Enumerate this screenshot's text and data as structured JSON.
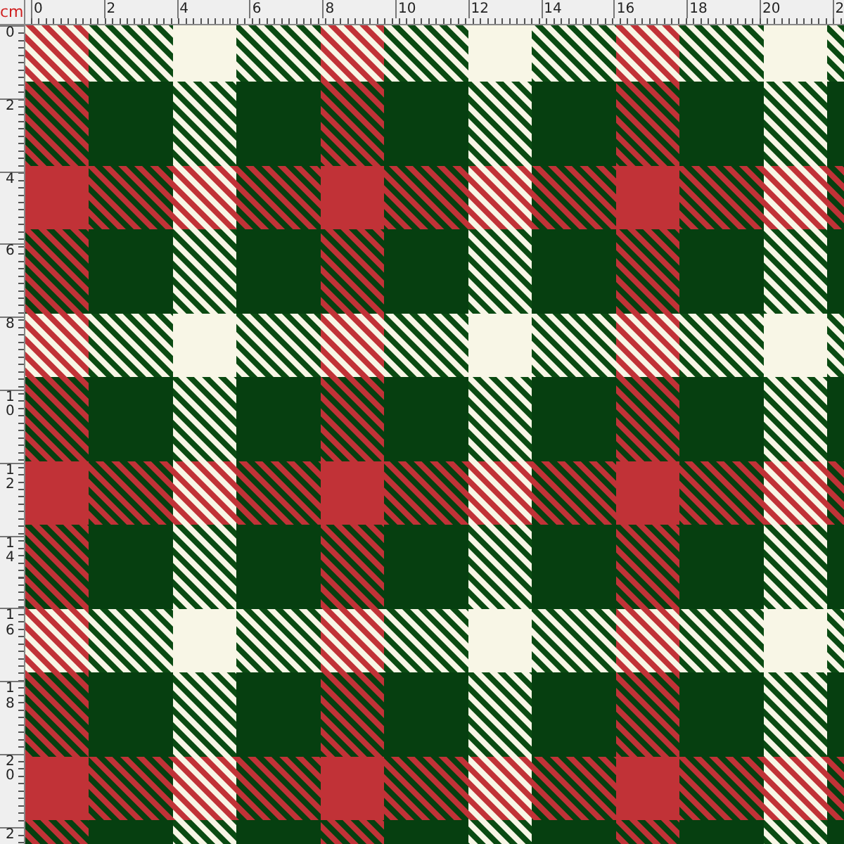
{
  "unit": "cm",
  "horizontal_ruler": {
    "labels": [
      "0",
      "2",
      "4",
      "6",
      "8",
      "10",
      "12",
      "14",
      "16",
      "18",
      "20",
      "2"
    ]
  },
  "vertical_ruler": {
    "labels": [
      "0",
      "2",
      "4",
      "6",
      "8",
      "10",
      "12",
      "14",
      "16",
      "18",
      "20",
      "2"
    ]
  }
}
